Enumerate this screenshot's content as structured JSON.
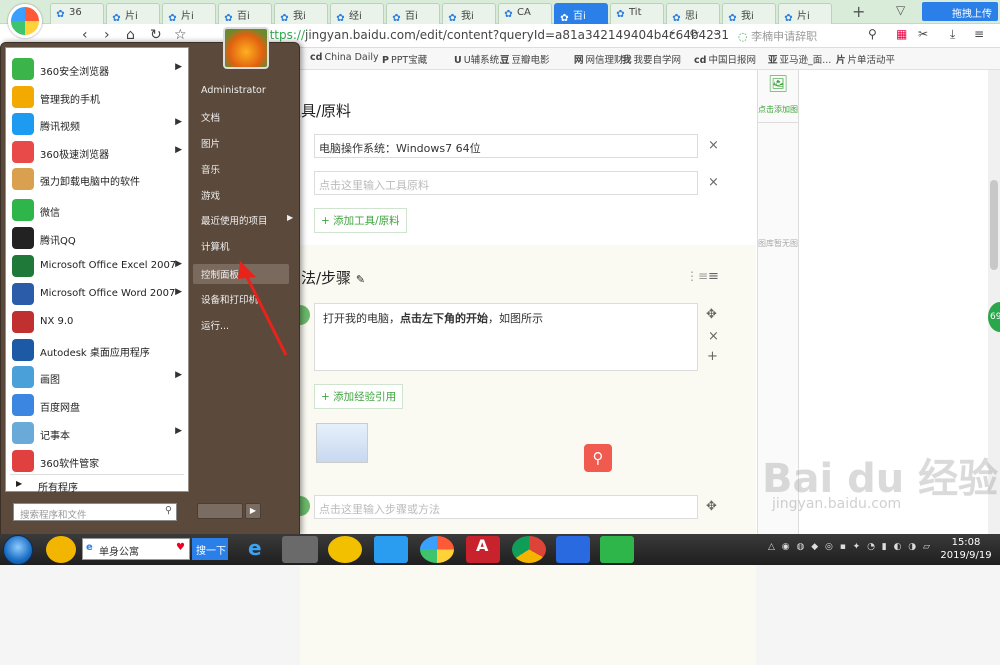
{
  "browser": {
    "tabs": [
      {
        "label": "36"
      },
      {
        "label": "片i"
      },
      {
        "label": "片i"
      },
      {
        "label": "百i"
      },
      {
        "label": "我i"
      },
      {
        "label": "经i"
      },
      {
        "label": "百i"
      },
      {
        "label": "我i"
      },
      {
        "label": "CA"
      },
      {
        "label": "百i",
        "active": true
      },
      {
        "label": "Tit"
      },
      {
        "label": "思i"
      },
      {
        "label": "我i"
      },
      {
        "label": "片i"
      }
    ],
    "new_tab": "+",
    "upload_button": "拖拽上传",
    "url_scheme": "https://",
    "url_rest": "jingyan.baidu.com/edit/content?queryId=a81a342149404b4c64b4231",
    "search_hint": "李楠申请辞职",
    "bookmarks": [
      {
        "icon": "cd",
        "label": "China Daily"
      },
      {
        "icon": "P",
        "label": "PPT宝藏"
      },
      {
        "icon": "U",
        "label": "U辅系统..."
      },
      {
        "icon": "豆",
        "label": "豆瓣电影"
      },
      {
        "icon": "网",
        "label": "网信理财"
      },
      {
        "icon": "我",
        "label": "我要自学网"
      },
      {
        "icon": "cd",
        "label": "中国日报网"
      },
      {
        "icon": "亚",
        "label": "亚马逊_面..."
      },
      {
        "icon": "片",
        "label": "片单活动平"
      }
    ]
  },
  "editor": {
    "tools_heading": "工具/原料",
    "tool_value": "电脑操作系统：Windows7 64位",
    "tool_placeholder": "点击这里输入工具原料",
    "add_tool": "+ 添加工具/原料",
    "steps_heading": "方法/步骤",
    "step_text_1": "打开我的电脑，",
    "step_text_bold": "点击左下角的开始",
    "step_text_2": "，如图所示",
    "add_reference": "+ 添加经验引用",
    "step_placeholder": "点击这里输入步骤或方法"
  },
  "sidepanel": {
    "add_image": "点击添加图片",
    "no_images": "图库暂无图片"
  },
  "start_menu": {
    "items": [
      {
        "label": "360安全浏览器",
        "arrow": true,
        "color": "#3bb54a"
      },
      {
        "label": "管理我的手机",
        "arrow": false,
        "color": "#f2a900"
      },
      {
        "label": "腾讯视频",
        "arrow": true,
        "color": "#1d9bf0"
      },
      {
        "label": "360极速浏览器",
        "arrow": true,
        "color": "#e84a4a"
      },
      {
        "label": "强力卸载电脑中的软件",
        "arrow": false,
        "color": "#d9a050"
      },
      {
        "label": "微信",
        "arrow": false,
        "color": "#2fb64a"
      },
      {
        "label": "腾讯QQ",
        "arrow": false,
        "color": "#222222"
      },
      {
        "label": "Microsoft Office Excel 2007",
        "arrow": true,
        "color": "#1f7a3a"
      },
      {
        "label": "Microsoft Office Word 2007",
        "arrow": true,
        "color": "#2a5caa"
      },
      {
        "label": "NX 9.0",
        "arrow": false,
        "color": "#c03030"
      },
      {
        "label": "Autodesk 桌面应用程序",
        "arrow": false,
        "color": "#1c5aa6"
      },
      {
        "label": "画图",
        "arrow": true,
        "color": "#4aa0d8"
      },
      {
        "label": "百度网盘",
        "arrow": false,
        "color": "#3a86e0"
      },
      {
        "label": "记事本",
        "arrow": true,
        "color": "#6aaad8"
      },
      {
        "label": "360软件管家",
        "arrow": false,
        "color": "#e04040"
      }
    ],
    "all_programs": "所有程序",
    "search_placeholder": "搜索程序和文件",
    "right_items": [
      {
        "label": "Administrator"
      },
      {
        "label": "文档"
      },
      {
        "label": "图片"
      },
      {
        "label": "音乐"
      },
      {
        "label": "游戏"
      },
      {
        "label": "最近使用的项目",
        "arrow": true
      },
      {
        "label": "计算机"
      },
      {
        "label": "控制面板",
        "hover": true
      },
      {
        "label": "设备和打印机"
      },
      {
        "label": "运行..."
      }
    ]
  },
  "taskbar": {
    "search_text": "单身公寓",
    "search_button": "搜一下",
    "time": "15:08",
    "date": "2019/9/19"
  },
  "watermark": {
    "text": "Bai du 经验",
    "url": "jingyan.baidu.com"
  },
  "badge": "69"
}
